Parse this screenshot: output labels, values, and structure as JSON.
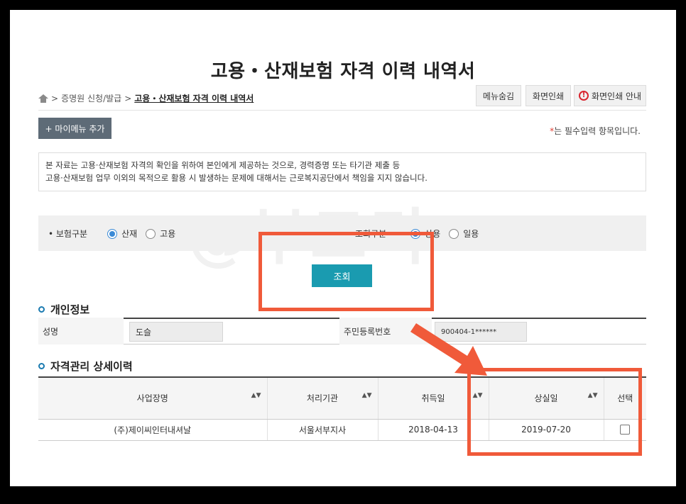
{
  "page": {
    "title": "고용・산재보험 자격 이력 내역서",
    "watermark": "@부드리"
  },
  "breadcrumb": {
    "items": [
      "증명원 신청/발급",
      "고용・산재보험 자격 이력 내역서"
    ]
  },
  "toolbar": {
    "hide_menu_label": "메뉴숨김",
    "print_label": "화면인쇄",
    "print_guide_label": "화면인쇄 안내"
  },
  "mymenu": {
    "add_label": "+ 마이메뉴 추가"
  },
  "required_note": {
    "star": "*",
    "text": "는 필수입력 항목입니다."
  },
  "notice": {
    "line1": "본 자료는 고용·산재보험 자격의 확인을 위하여 본인에게 제공하는 것으로, 경력증명 또는 타기관 제출 등",
    "line2": "고용·산재보험 업무 이외의 목적으로 활용 시 발생하는 문제에 대해서는 근로복지공단에서 책임을 지지 않습니다."
  },
  "filters": {
    "insurance_type": {
      "label": "• 보험구분",
      "options": [
        "산재",
        "고용"
      ],
      "selected": "산재"
    },
    "employment_type": {
      "label": "조회구분",
      "options": [
        "상용",
        "일용"
      ],
      "selected": "상용"
    }
  },
  "search": {
    "label": "조회"
  },
  "personal_info": {
    "section_title": "개인정보",
    "name_label": "성명",
    "name_value": "도슬",
    "rrn_label": "주민등록번호",
    "rrn_value": "900404-1******"
  },
  "history": {
    "section_title": "자격관리 상세이력",
    "columns": [
      "사업장명",
      "처리기관",
      "취득일",
      "상실일",
      "선택"
    ],
    "rows": [
      {
        "workplace": "(주)제이씨인터내셔날",
        "office": "서울서부지사",
        "acquired": "2018-04-13",
        "lost": "2019-07-20"
      }
    ]
  },
  "annotation_color": "#f05a3a"
}
